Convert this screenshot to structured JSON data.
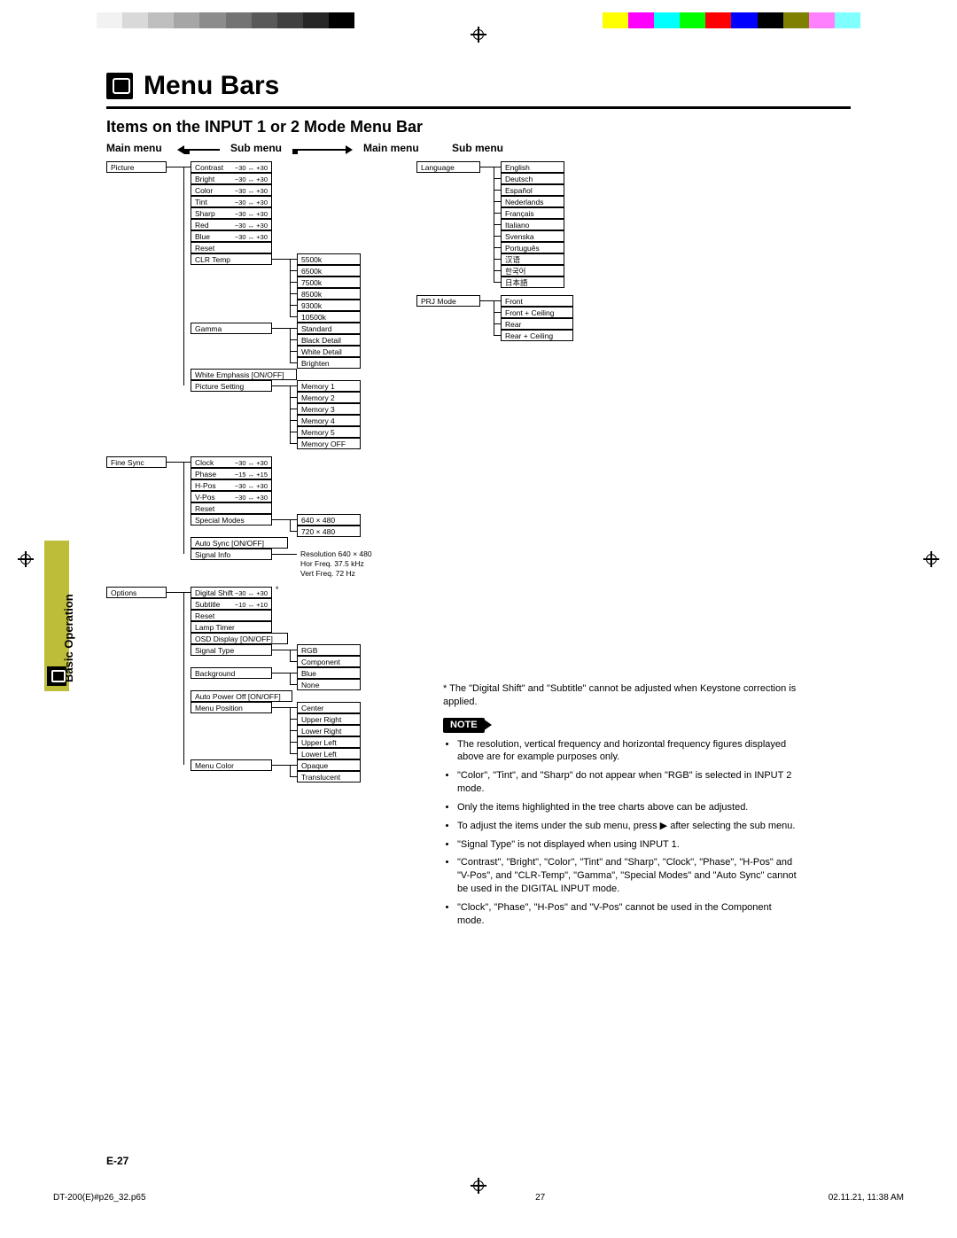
{
  "colorbars_left": [
    "#ffffff",
    "#f2f2f2",
    "#d9d9d9",
    "#bfbfbf",
    "#a6a6a6",
    "#8c8c8c",
    "#737373",
    "#595959",
    "#404040",
    "#262626",
    "#000000"
  ],
  "colorbars_right": [
    "#ffff00",
    "#ff00ff",
    "#00ffff",
    "#00ff00",
    "#ff0000",
    "#0000ff",
    "#000000",
    "#808000",
    "#ff80ff",
    "#80ffff",
    "#ffffff"
  ],
  "title": "Menu Bars",
  "section_title": "Items on the INPUT 1 or 2 Mode Menu Bar",
  "colheads": {
    "main1": "Main menu",
    "sub1": "Sub menu",
    "main2": "Main menu",
    "sub2": "Sub menu"
  },
  "sidetab": "Basic Operation",
  "page_label": "E-27",
  "footer": {
    "file": "DT-200(E)#p26_32.p65",
    "num": "27",
    "date": "02.11.21, 11:38 AM"
  },
  "picture": {
    "label": "Picture",
    "sliders": [
      {
        "name": "Contrast",
        "range": "−30 ↔ +30"
      },
      {
        "name": "Bright",
        "range": "−30 ↔ +30"
      },
      {
        "name": "Color",
        "range": "−30 ↔ +30"
      },
      {
        "name": "Tint",
        "range": "−30 ↔ +30"
      },
      {
        "name": "Sharp",
        "range": "−30 ↔ +30"
      },
      {
        "name": "Red",
        "range": "−30 ↔ +30"
      },
      {
        "name": "Blue",
        "range": "−30 ↔ +30"
      }
    ],
    "reset": "Reset",
    "clr_temp": {
      "label": "CLR Temp",
      "options": [
        "5500k",
        "6500k",
        "7500k",
        "8500k",
        "9300k",
        "10500k"
      ]
    },
    "gamma": {
      "label": "Gamma",
      "options": [
        "Standard",
        "Black Detail",
        "White Detail",
        "Brighten"
      ]
    },
    "white_emphasis": "White Emphasis   [ON/OFF]",
    "picture_setting": {
      "label": "Picture Setting",
      "options": [
        "Memory 1",
        "Memory 2",
        "Memory 3",
        "Memory 4",
        "Memory 5",
        "Memory OFF"
      ]
    }
  },
  "finesync": {
    "label": "Fine Sync",
    "sliders": [
      {
        "name": "Clock",
        "range": "−30 ↔ +30"
      },
      {
        "name": "Phase",
        "range": "−15 ↔ +15"
      },
      {
        "name": "H-Pos",
        "range": "−30 ↔ +30"
      },
      {
        "name": "V-Pos",
        "range": "−30 ↔ +30"
      }
    ],
    "reset": "Reset",
    "special_modes": {
      "label": "Special Modes",
      "options": [
        "640 × 480",
        "720 × 480"
      ]
    },
    "auto_sync": "Auto Sync      [ON/OFF]",
    "signal_info": {
      "label": "Signal Info",
      "lines": [
        "Resolution    640 × 480",
        "Hor Freq.      37.5 kHz",
        "Vert Freq.     72 Hz"
      ]
    }
  },
  "options": {
    "label": "Options",
    "sliders": [
      {
        "name": "Digital Shift",
        "range": "−30 ↔ +30"
      },
      {
        "name": "Subtitle",
        "range": "−10 ↔ +10"
      }
    ],
    "reset": "Reset",
    "lamp": "Lamp Timer",
    "osd": "OSD Display   [ON/OFF]",
    "signal_type": {
      "label": "Signal Type",
      "options": [
        "RGB",
        "Component"
      ]
    },
    "background": {
      "label": "Background",
      "options": [
        "Blue",
        "None"
      ]
    },
    "auto_power": "Auto Power Off [ON/OFF]",
    "menu_pos": {
      "label": "Menu Position",
      "options": [
        "Center",
        "Upper Right",
        "Lower Right",
        "Upper Left",
        "Lower Left"
      ]
    },
    "menu_color": {
      "label": "Menu Color",
      "options": [
        "Opaque",
        "Translucent"
      ]
    }
  },
  "language": {
    "label": "Language",
    "options": [
      "English",
      "Deutsch",
      "Español",
      "Nederlands",
      "Français",
      "Italiano",
      "Svenska",
      "Português",
      "汉语",
      "한국어",
      "日本語"
    ]
  },
  "prj": {
    "label": "PRJ Mode",
    "options": [
      "Front",
      "Front + Ceiling",
      "Rear",
      "Rear + Ceiling"
    ]
  },
  "notes": {
    "star": "* The \"Digital Shift\" and \"Subtitle\" cannot be adjusted when Keystone correction is applied.",
    "badge": "NOTE",
    "items": [
      "The resolution, vertical frequency and horizontal frequency figures displayed above are for example purposes only.",
      "\"Color\", \"Tint\", and \"Sharp\" do not appear when \"RGB\" is selected in INPUT 2 mode.",
      "Only the items highlighted in the tree charts above can be adjusted.",
      "To adjust the items under the sub menu, press ▶ after selecting the sub menu.",
      "\"Signal Type\" is not displayed when using INPUT 1.",
      "\"Contrast\", \"Bright\", \"Color\", \"Tint\" and \"Sharp\", \"Clock\", \"Phase\", \"H-Pos\" and \"V-Pos\", and \"CLR-Temp\", \"Gamma\", \"Special Modes\" and \"Auto Sync\" cannot be used in the DIGITAL INPUT mode.",
      "\"Clock\", \"Phase\", \"H-Pos\" and \"V-Pos\" cannot be used in the Component mode."
    ]
  }
}
